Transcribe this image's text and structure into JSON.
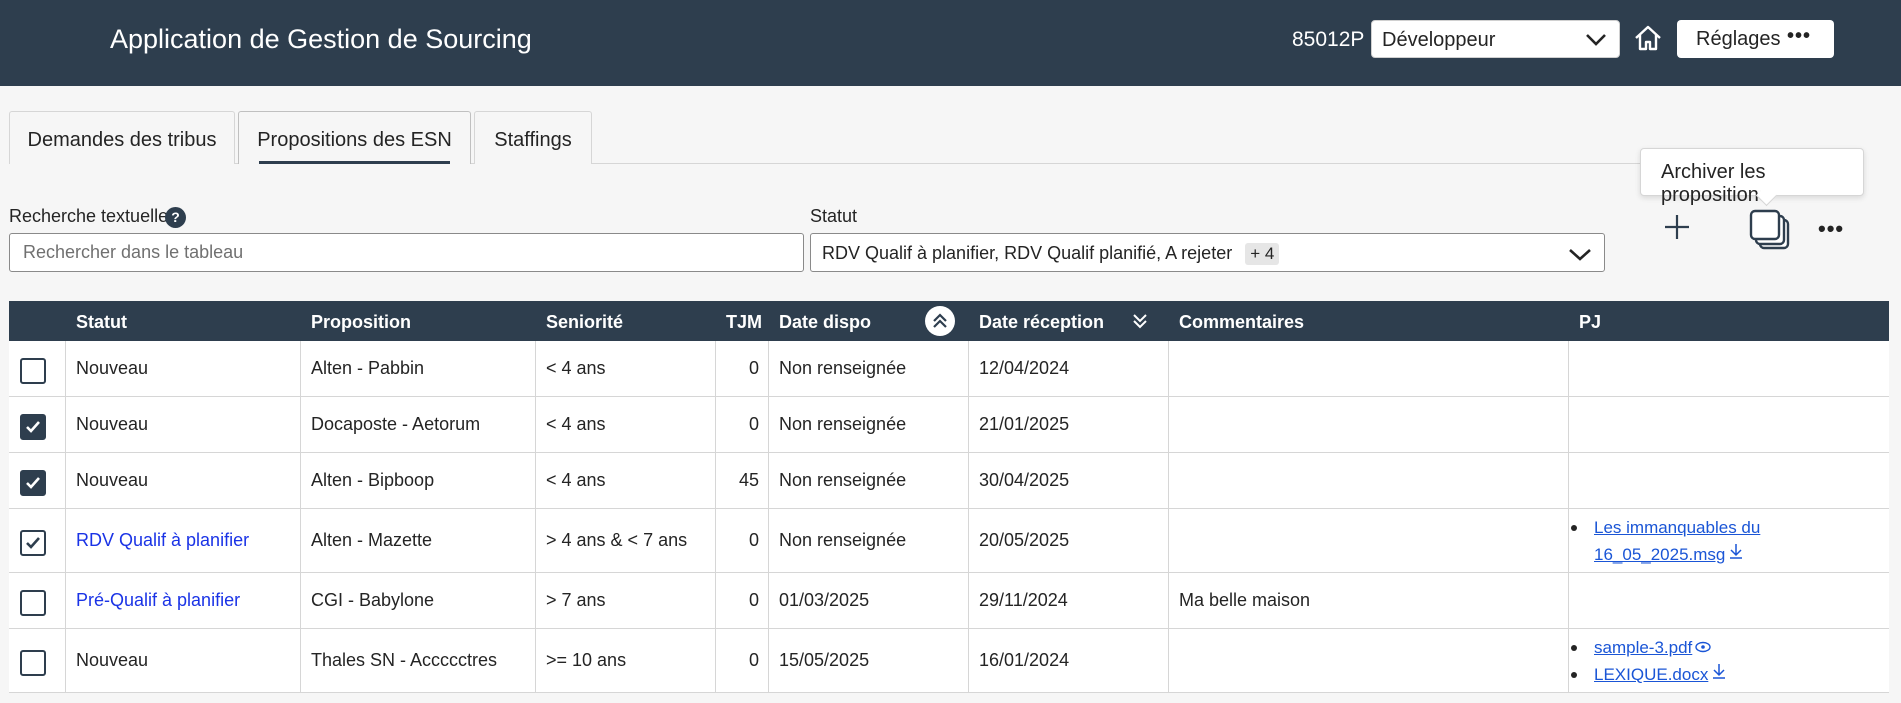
{
  "header": {
    "app_title": "Application de Gestion de Sourcing",
    "user_code": "85012P",
    "role_select": "Développeur",
    "settings_label": "Réglages",
    "bg_color": "#2e3e4e"
  },
  "tabs": [
    {
      "label": "Demandes des tribus",
      "active": false
    },
    {
      "label": "Propositions des ESN",
      "active": true
    },
    {
      "label": "Staffings",
      "active": false
    }
  ],
  "tooltip": "Archiver les propositions",
  "filters": {
    "search_label": "Recherche textuelle",
    "search_placeholder": "Rechercher dans le tableau",
    "status_label": "Statut",
    "status_value": "RDV Qualif à planifier, RDV Qualif planifié, A rejeter",
    "status_more": "+ 4"
  },
  "table": {
    "headers": [
      "Statut",
      "Proposition",
      "Seniorité",
      "TJM",
      "Date dispo",
      "Date réception",
      "Commentaires",
      "PJ"
    ],
    "rows": [
      {
        "checked": "unchecked",
        "statut": "Nouveau",
        "proposition": "Alten - Pabbin",
        "seniorite": "< 4 ans",
        "tjm": "0",
        "date_dispo": "Non renseignée",
        "date_reception": "12/04/2024",
        "commentaires": "",
        "pj": []
      },
      {
        "checked": "checked",
        "statut": "Nouveau",
        "proposition": "Docaposte - Aetorum",
        "seniorite": "< 4 ans",
        "tjm": "0",
        "date_dispo": "Non renseignée",
        "date_reception": "21/01/2025",
        "commentaires": "",
        "pj": []
      },
      {
        "checked": "checked",
        "statut": "Nouveau",
        "proposition": "Alten - Bipboop",
        "seniorite": "< 4 ans",
        "tjm": "45",
        "date_dispo": "Non renseignée",
        "date_reception": "30/04/2025",
        "commentaires": "",
        "pj": []
      },
      {
        "checked": "checked-outline",
        "statut": "RDV Qualif à planifier",
        "proposition": "Alten - Mazette",
        "seniorite": "> 4 ans & < 7 ans",
        "tjm": "0",
        "date_dispo": "Non renseignée",
        "date_reception": "20/05/2025",
        "commentaires": "",
        "pj": [
          {
            "line1": "Les immanquables du",
            "line2": "16_05_2025.msg",
            "icon": "download-icon"
          }
        ]
      },
      {
        "checked": "unchecked",
        "statut": "Pré-Qualif à planifier",
        "proposition": "CGI - Babylone",
        "seniorite": "> 7 ans",
        "tjm": "0",
        "date_dispo": "01/03/2025",
        "date_reception": "29/11/2024",
        "commentaires": "Ma belle maison",
        "pj": []
      },
      {
        "checked": "unchecked",
        "statut": "Nouveau",
        "proposition": "Thales SN - Accccctres",
        "seniorite": ">= 10 ans",
        "tjm": "0",
        "date_dispo": "15/05/2025",
        "date_reception": "16/01/2024",
        "commentaires": "",
        "pj": [
          {
            "name": "sample-3.pdf",
            "icon": "eye-icon"
          },
          {
            "name": "LEXIQUE.docx",
            "icon": "download-icon"
          }
        ]
      }
    ]
  }
}
